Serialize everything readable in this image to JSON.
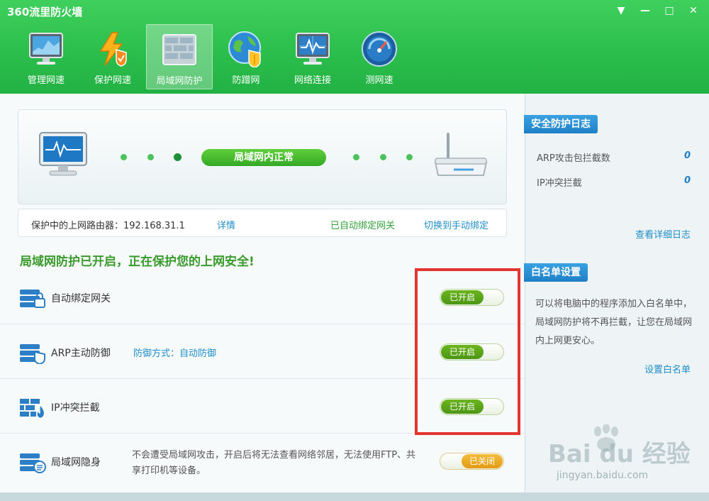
{
  "window": {
    "title": "360流里防火墙",
    "controls": [
      "▼",
      "—",
      "□",
      "✕"
    ]
  },
  "toolbar": {
    "active_index": 2,
    "items": [
      {
        "label": "管理网速",
        "icon": "monitor-chart-icon"
      },
      {
        "label": "保护网速",
        "icon": "lightning-shield-icon"
      },
      {
        "label": "局域网防护",
        "icon": "firewall-brick-icon"
      },
      {
        "label": "防蹭网",
        "icon": "globe-shield-icon"
      },
      {
        "label": "网络连接",
        "icon": "network-monitor-icon"
      },
      {
        "label": "测网速",
        "icon": "speedometer-icon"
      }
    ]
  },
  "status": {
    "text": "局域网内正常",
    "computer_icon": "computer-icon",
    "router_icon": "router-icon"
  },
  "router_bar": {
    "label": "保护中的上网路由器：192.168.31.1",
    "details_link": "详情",
    "auto_bind_text": "已自动绑定网关",
    "switch_link": "切换到手动绑定"
  },
  "headline": "局域网防护已开启，正在保护您的上网安全!",
  "features": [
    {
      "name": "自动绑定网关",
      "icon": "server-lock-icon",
      "extra": "",
      "desc": "",
      "toggle": "已开启",
      "on": true
    },
    {
      "name": "ARP主动防御",
      "icon": "server-shield-icon",
      "extra": "防御方式：自动防御",
      "desc": "",
      "toggle": "已开启",
      "on": true
    },
    {
      "name": "IP冲突拦截",
      "icon": "firewall-flame-icon",
      "extra": "",
      "desc": "",
      "toggle": "已开启",
      "on": true
    },
    {
      "name": "局域网隐身",
      "icon": "server-list-icon",
      "extra": "",
      "desc": "不会遭受局域网攻击，开启后将无法查看网络邻居，无法使用FTP、共享打印机等设备。",
      "toggle": "已关闭",
      "on": false
    }
  ],
  "sidebar": {
    "log_title": "安全防护日志",
    "log_rows": [
      {
        "label": "ARP攻击包拦截数",
        "value": "0"
      },
      {
        "label": "IP冲突拦截",
        "value": "0"
      }
    ],
    "log_link": "查看详细日志",
    "whitelist_title": "白名单设置",
    "whitelist_text": "可以将电脑中的程序添加入白名单中，局域网防护将不再拦截，让您在局域网内上网更安心。",
    "whitelist_link": "设置白名单"
  },
  "watermark": {
    "word": "Bai  du 经验",
    "url": "jingyan.baidu.com"
  },
  "colors": {
    "brand_green": "#2bbd4b",
    "toggle_on": "#5aa51a",
    "toggle_off": "#eaa420",
    "highlight_red": "#e2352f",
    "link_blue": "#1f8ec9"
  }
}
